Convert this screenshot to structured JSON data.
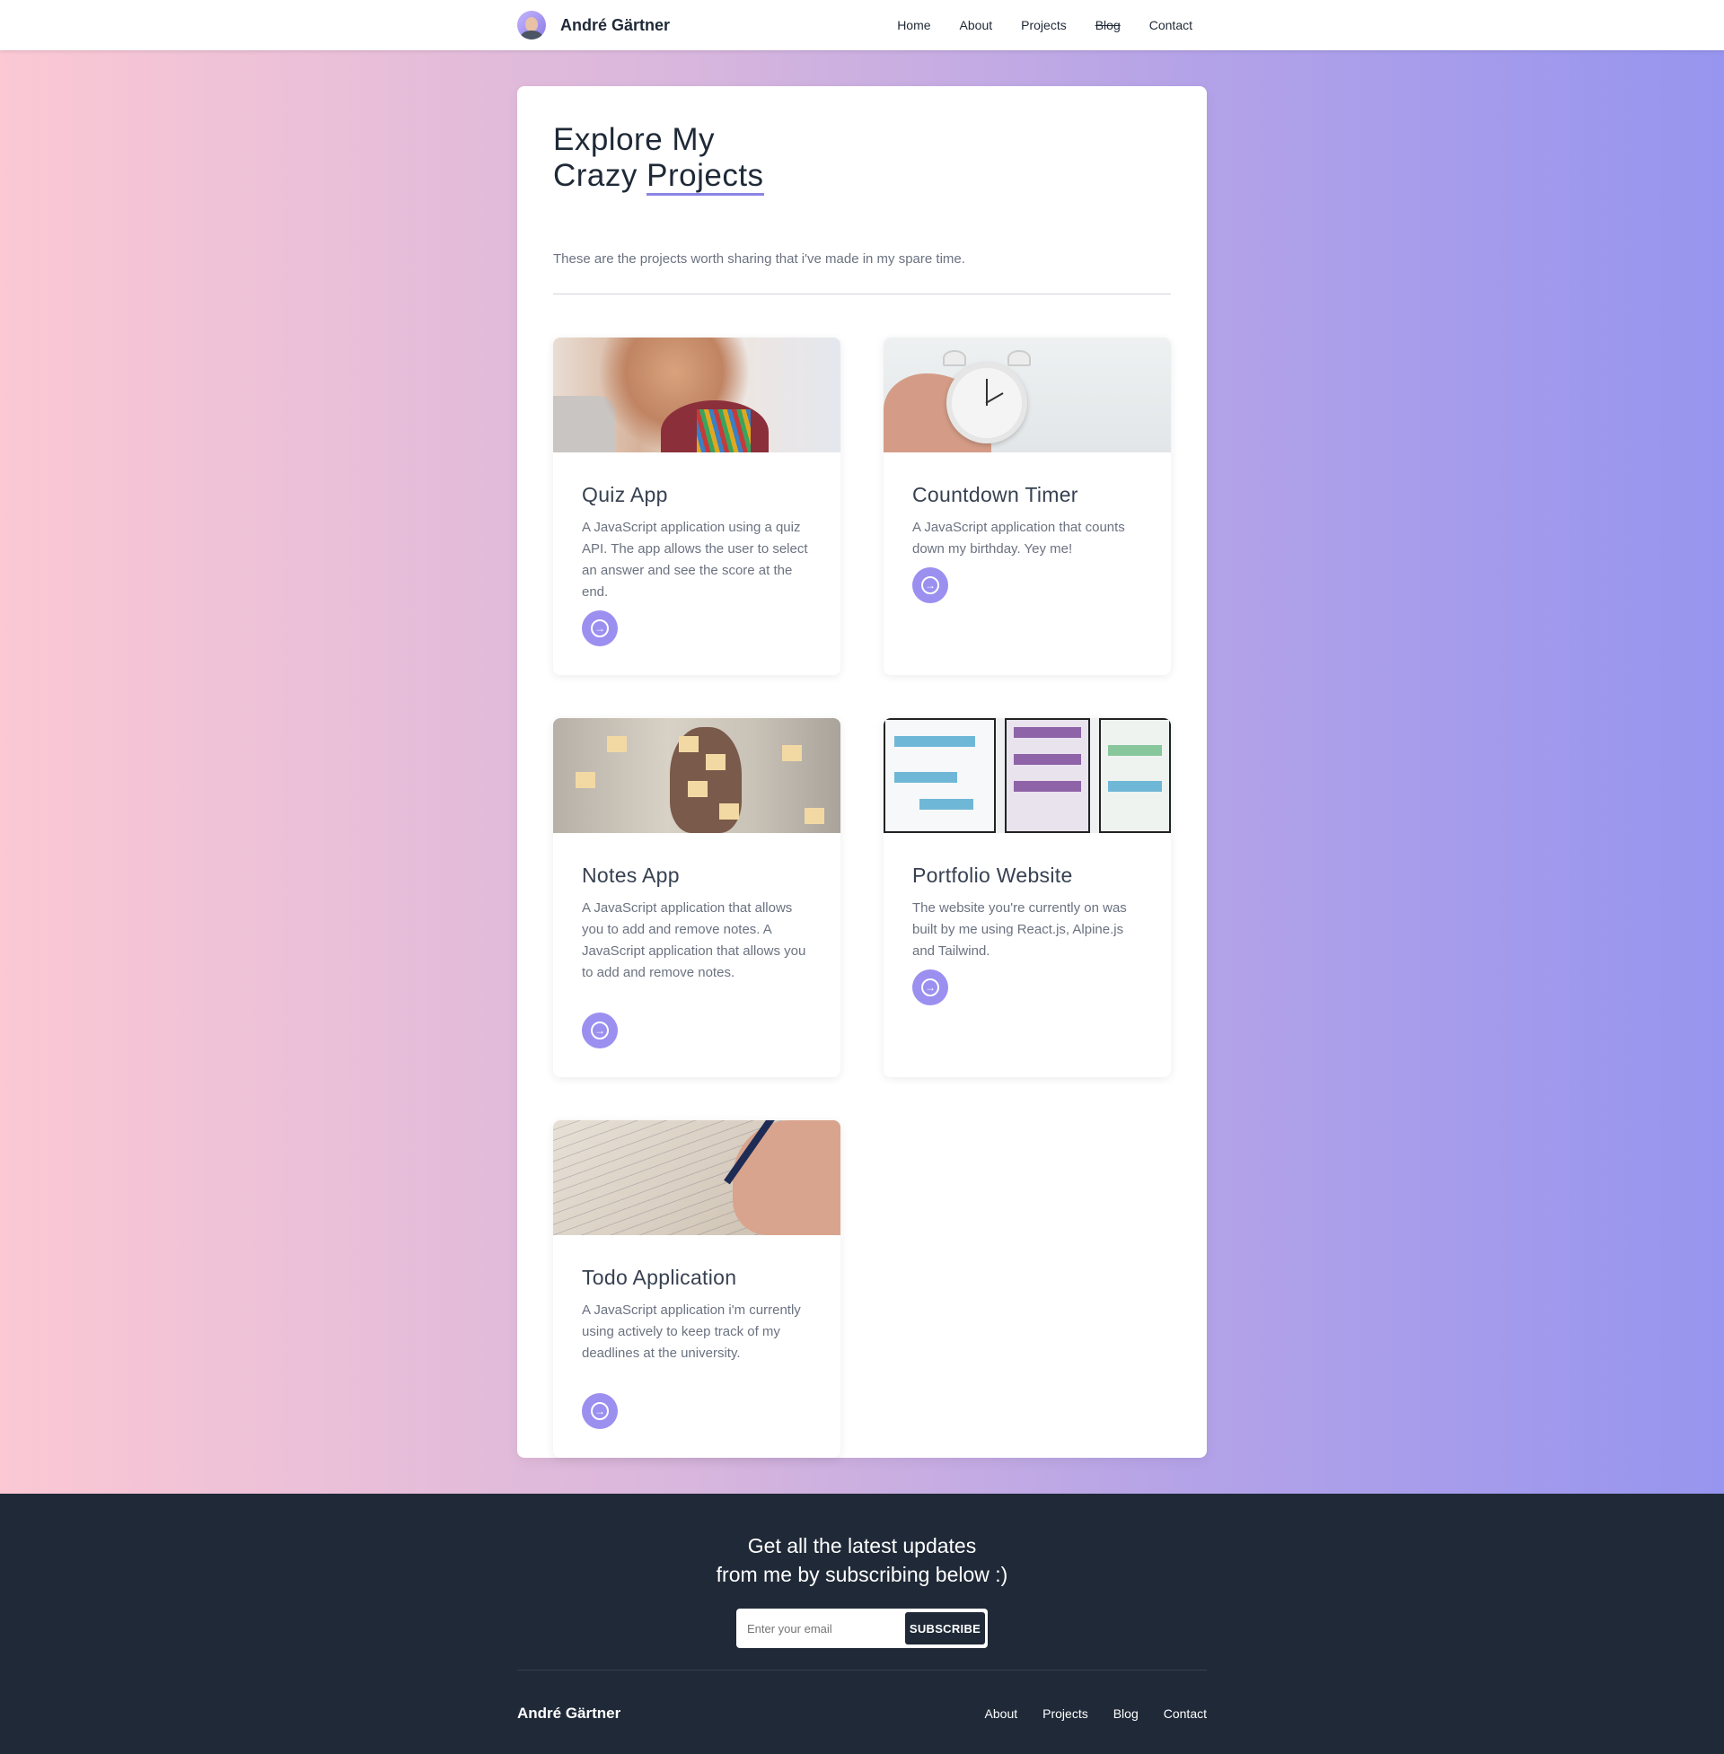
{
  "nav": {
    "brand": "André Gärtner",
    "links": [
      "Home",
      "About",
      "Projects",
      "Blog",
      "Contact"
    ]
  },
  "hero": {
    "title_line1": "Explore My",
    "title_line2_a": "Crazy ",
    "title_line2_b": "Projects",
    "intro": "These are the projects worth sharing that i've made in my spare time."
  },
  "projects": [
    {
      "title": "Quiz App",
      "desc": "A JavaScript application using a quiz API. The app allows the user to select an answer and see the score at the end.",
      "image": "woman-with-pencils-photo"
    },
    {
      "title": "Countdown Timer",
      "desc": "A JavaScript application that counts down my birthday. Yey me!",
      "image": "alarm-clock-photo"
    },
    {
      "title": "Notes App",
      "desc": "A JavaScript application that allows you to add and remove notes. A JavaScript application that allows you to add and remove notes.",
      "image": "sticky-notes-face-photo"
    },
    {
      "title": "Portfolio Website",
      "desc": "The website you're currently on was built by me using React.js, Alpine.js and Tailwind.",
      "image": "wireframe-sketches-photo"
    },
    {
      "title": "Todo Application",
      "desc": "A JavaScript application i'm currently using actively to keep track of my deadlines at the university.",
      "image": "checklist-writing-photo"
    }
  ],
  "footer": {
    "heading_line1": "Get all the latest updates",
    "heading_line2": "from me by subscribing below :)",
    "email_placeholder": "Enter your email",
    "subscribe_label": "SUBSCRIBE",
    "brand": "André Gärtner",
    "links": [
      "About",
      "Projects",
      "Blog",
      "Contact"
    ]
  },
  "colors": {
    "accent": "#9b8ff0",
    "footer_bg": "#1f2937",
    "gradient_start": "#fbc8d4",
    "gradient_end": "#9795ef"
  }
}
